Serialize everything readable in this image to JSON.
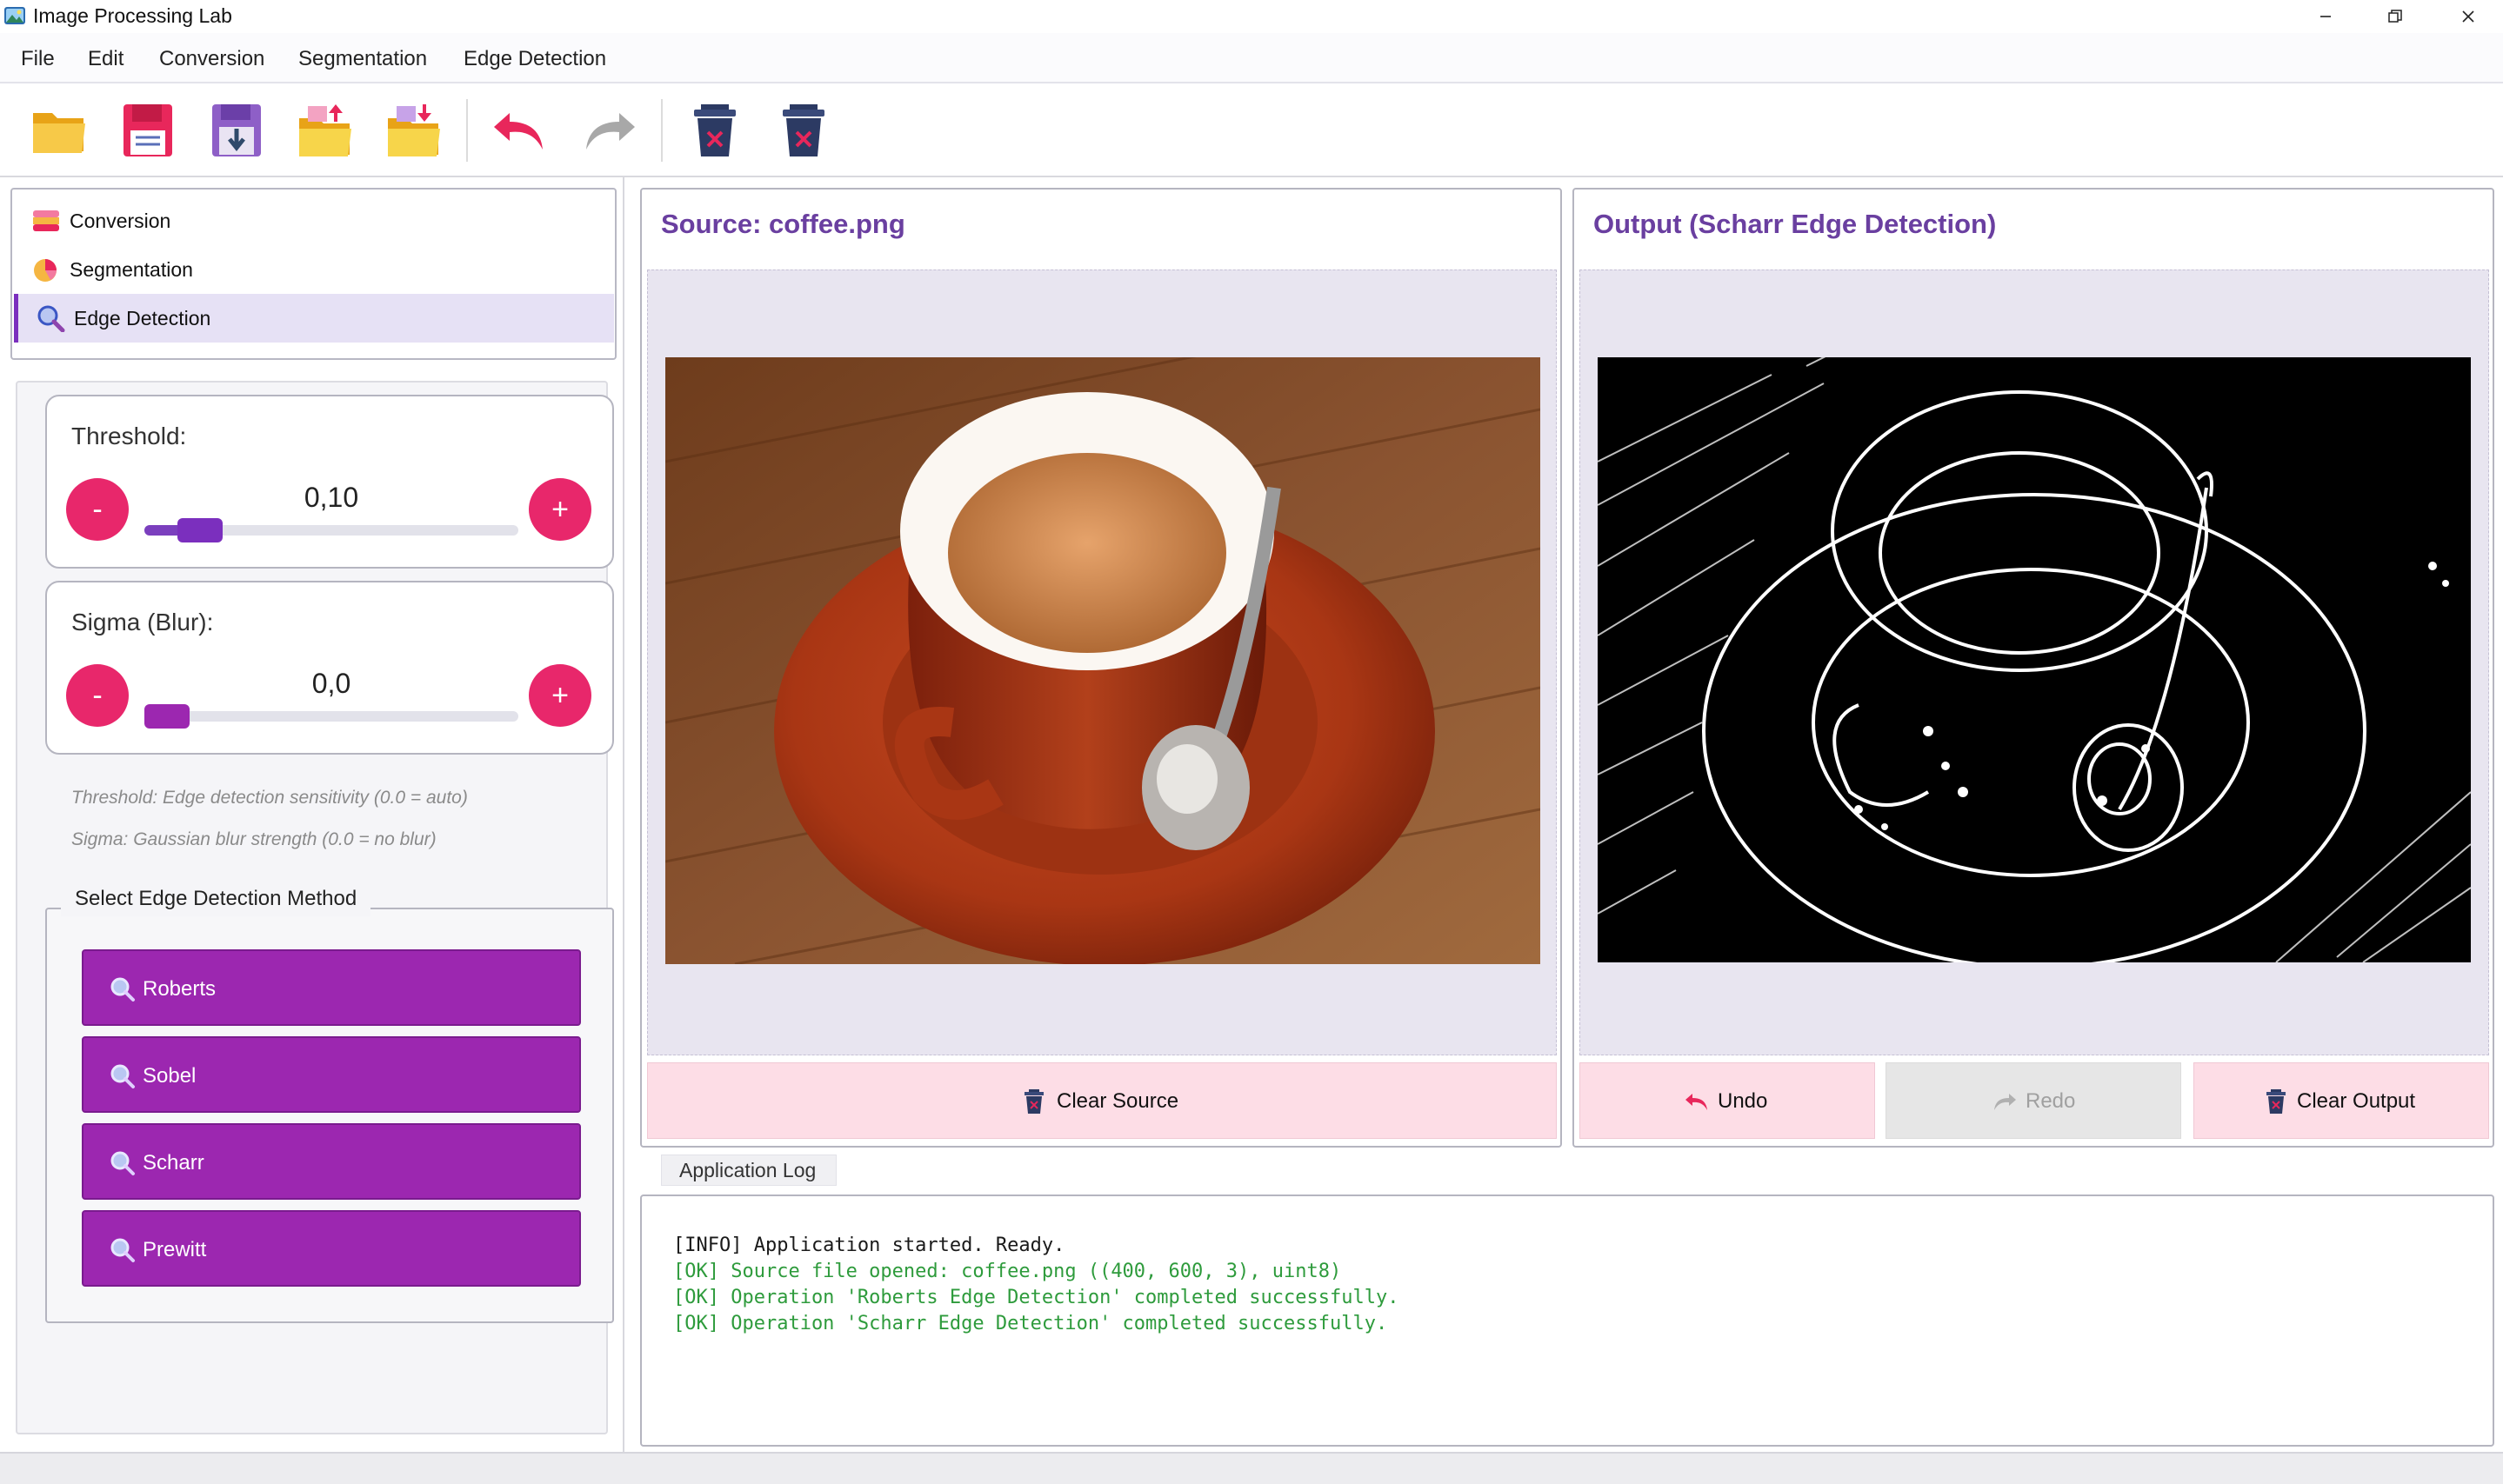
{
  "window": {
    "title": "Image Processing Lab",
    "minimize": "—",
    "maximize": "❐",
    "close": "✕"
  },
  "menu": [
    "File",
    "Edit",
    "Conversion",
    "Segmentation",
    "Edge Detection"
  ],
  "toolbar": {
    "icons": [
      "open-folder-icon",
      "save-icon",
      "save-as-icon",
      "import-icon",
      "export-icon",
      "undo-icon",
      "redo-icon",
      "clear-source-icon",
      "clear-output-icon"
    ]
  },
  "nav": {
    "items": [
      {
        "label": "Conversion",
        "icon": "conversion-icon"
      },
      {
        "label": "Segmentation",
        "icon": "segmentation-icon"
      },
      {
        "label": "Edge Detection",
        "icon": "edge-detection-icon"
      }
    ],
    "selected": "Edge Detection"
  },
  "params": {
    "threshold": {
      "label": "Threshold:",
      "value": "0,10",
      "minus": "-",
      "plus": "+",
      "level": 0.1
    },
    "sigma": {
      "label": "Sigma (Blur):",
      "value": "0,0",
      "minus": "-",
      "plus": "+",
      "level": 0.0
    },
    "hint_threshold": "Threshold: Edge detection sensitivity (0.0 = auto)",
    "hint_sigma": "Sigma: Gaussian blur strength (0.0 = no blur)"
  },
  "methods": {
    "legend": "Select Edge Detection Method",
    "buttons": [
      "Roberts",
      "Sobel",
      "Scharr",
      "Prewitt"
    ]
  },
  "source": {
    "title": "Source: coffee.png",
    "clear_label": "Clear Source"
  },
  "output": {
    "title": "Output (Scharr Edge Detection)",
    "undo_label": "Undo",
    "redo_label": "Redo",
    "clear_label": "Clear Output"
  },
  "log": {
    "tab_label": "Application Log",
    "lines": [
      {
        "text": "[INFO] Application started. Ready.",
        "color": "#1a1a1a"
      },
      {
        "text": "[OK] Source file opened: coffee.png ((400, 600, 3), uint8)",
        "color": "#2e9b3c"
      },
      {
        "text": "[OK] Operation 'Roberts Edge Detection' completed successfully.",
        "color": "#2e9b3c"
      },
      {
        "text": "[OK] Operation 'Scharr Edge Detection' completed successfully.",
        "color": "#2e9b3c"
      }
    ]
  },
  "colors": {
    "accent_purple": "#9c27b0",
    "title_purple": "#6a3fa0",
    "pink_button": "#e8276b",
    "panel_button_bg": "#fddde6",
    "ok_green": "#2e9b3c"
  }
}
